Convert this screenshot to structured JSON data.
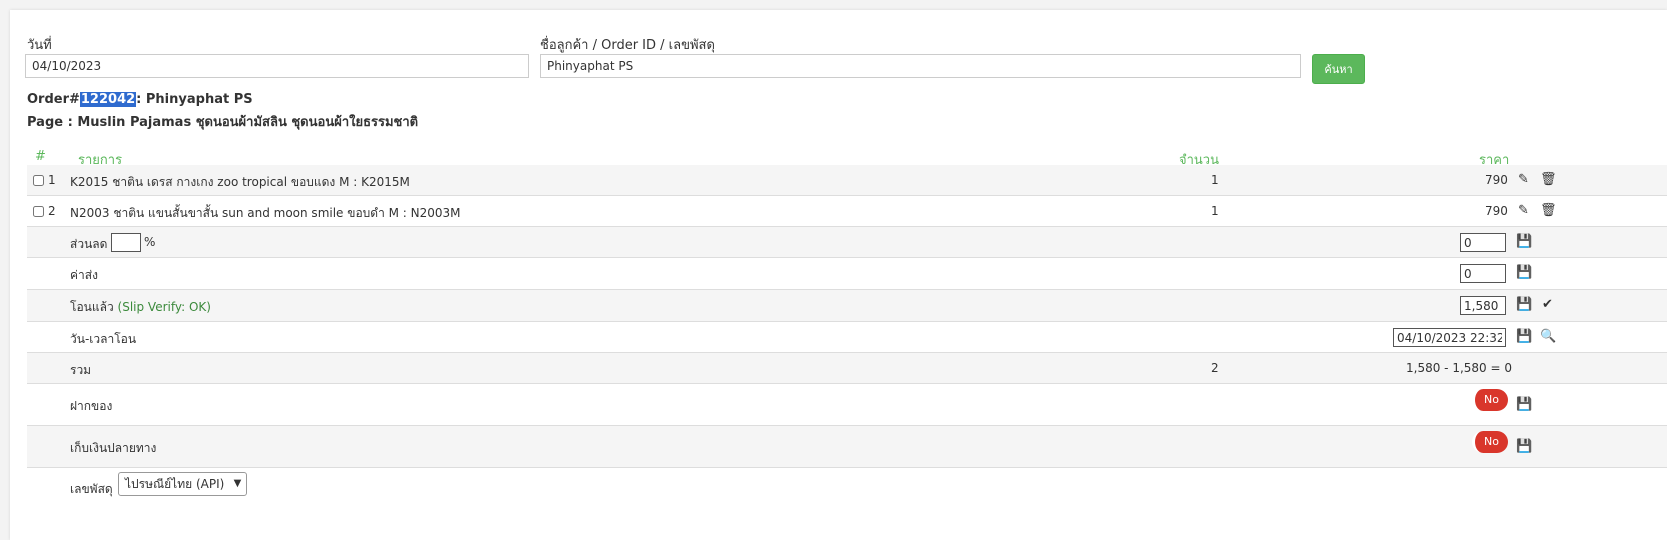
{
  "search": {
    "date_label": "วันที่",
    "date_value": "04/10/2023",
    "customer_label": "ชื่อลูกค้า / Order ID / เลขพัสดุ",
    "customer_value": "Phinyaphat PS",
    "search_button": "ค้นหา"
  },
  "order": {
    "prefix": "Order#",
    "id": "122042",
    "customer": ": Phinyaphat PS",
    "page_line": "Page : Muslin Pajamas ชุดนอนผ้ามัสลิน ชุดนอนผ้าใยธรรมชาติ"
  },
  "table": {
    "headers": {
      "num": "#",
      "item": "รายการ",
      "qty": "จำนวน",
      "price": "ราคา"
    },
    "items": [
      {
        "no": "1",
        "name": "K2015 ชาติน เดรส กางเกง zoo tropical ขอบแดง M : K2015M",
        "qty": "1",
        "price": "790"
      },
      {
        "no": "2",
        "name": "N2003 ชาติน แขนสั้นขาสั้น sun and moon smile ขอบดำ M : N2003M",
        "qty": "1",
        "price": "790"
      }
    ],
    "discount": {
      "label": "ส่วนลด",
      "unit": "%",
      "percent_value": "",
      "value": "0"
    },
    "shipping": {
      "label": "ค่าส่ง",
      "value": "0"
    },
    "transfer": {
      "label": "โอนแล้ว",
      "status": "(Slip Verify: OK)",
      "value": "1,580"
    },
    "transfer_time": {
      "label": "วัน-เวลาโอน",
      "value": "04/10/2023 22:32"
    },
    "total": {
      "label": "รวม",
      "qty": "2",
      "value": "1,580 - 1,580 = 0"
    },
    "deposit": {
      "label": "ฝากของ",
      "toggle": "No"
    },
    "cod": {
      "label": "เก็บเงินปลายทาง",
      "toggle": "No"
    },
    "tracking": {
      "label": "เลขพัสดุ",
      "carrier": "ไปรษณีย์ไทย (API)"
    }
  },
  "icons": {
    "edit": "pencil-icon",
    "delete": "trash-icon",
    "save": "floppy-disk-icon",
    "check": "check-icon",
    "search": "search-icon"
  },
  "colors": {
    "accent_green": "#5cb85c",
    "toggle_red": "#d9362b",
    "highlight_blue": "#2f6bcf"
  }
}
